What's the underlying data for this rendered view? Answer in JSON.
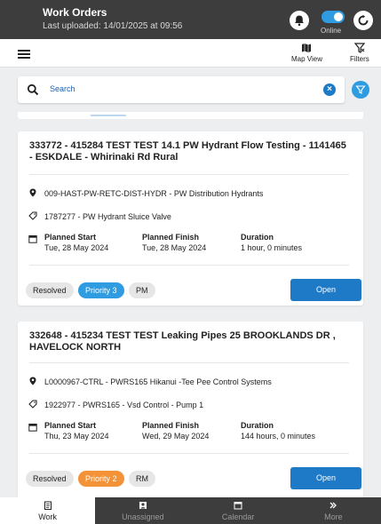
{
  "header": {
    "title": "Work Orders",
    "subtitle": "Last uploaded: 14/01/2025 at 09:56",
    "online_label": "Online"
  },
  "toolbar": {
    "map_view": "Map View",
    "filters": "Filters"
  },
  "search": {
    "placeholder": "Search",
    "clear_icon": "×"
  },
  "cards": [
    {
      "title": "333772 - 415284 TEST TEST 14.1 PW Hydrant Flow Testing - 1141465 - ESKDALE - Whirinaki Rd Rural",
      "location": "009-HAST-PW-RETC-DIST-HYDR - PW Distribution Hydrants",
      "asset": "1787277 - PW Hydrant Sluice Valve",
      "planned_start_label": "Planned Start",
      "planned_start": "Tue, 28 May 2024",
      "planned_finish_label": "Planned Finish",
      "planned_finish": "Tue, 28 May 2024",
      "duration_label": "Duration",
      "duration": "1 hour, 0 minutes",
      "chips": [
        "Resolved",
        "Priority 3",
        "PM"
      ],
      "open_label": "Open"
    },
    {
      "title": "332648 - 415234 TEST TEST Leaking Pipes 25 BROOKLANDS DR , HAVELOCK NORTH",
      "location": "L0000967-CTRL - PWRS165 Hikanui -Tee Pee Control Systems",
      "asset": "1922977 - PWRS165 - Vsd Control - Pump 1",
      "planned_start_label": "Planned Start",
      "planned_start": "Thu, 23 May 2024",
      "planned_finish_label": "Planned Finish",
      "planned_finish": "Wed, 29 May 2024",
      "duration_label": "Duration",
      "duration": "144 hours, 0 minutes",
      "chips": [
        "Resolved",
        "Priority 2",
        "RM"
      ],
      "open_label": "Open"
    }
  ],
  "bottom_nav": [
    "Work",
    "Unassigned",
    "Calendar",
    "More"
  ],
  "colors": {
    "header_bg": "#3d3d3d",
    "accent_blue": "#1e79c7",
    "priority3": "#2f9be0",
    "priority2": "#f39237"
  }
}
